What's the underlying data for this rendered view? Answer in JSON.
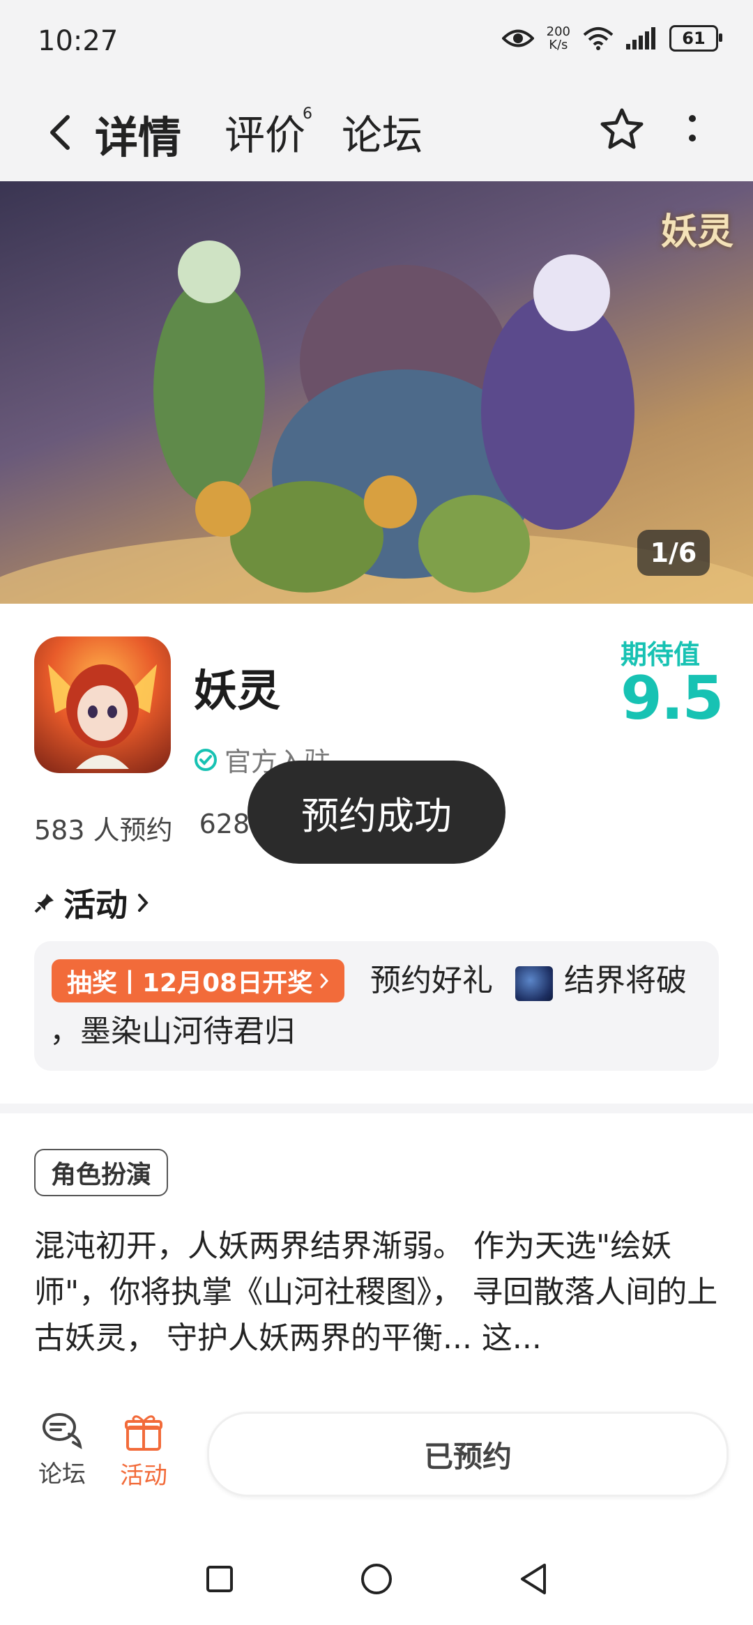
{
  "status_bar": {
    "time": "10:27",
    "network_speed_value": "200",
    "network_speed_unit": "K/s",
    "battery": "61",
    "icons": [
      "eye-icon",
      "wifi-icon",
      "signal-icon",
      "battery-icon"
    ]
  },
  "nav": {
    "tabs": [
      {
        "label": "详情",
        "active": true
      },
      {
        "label": "评价",
        "badge": "6"
      },
      {
        "label": "论坛"
      }
    ]
  },
  "banner": {
    "logo_text": "妖灵",
    "counter": "1/6"
  },
  "app": {
    "name": "妖灵",
    "official_label": "官方入驻",
    "rating_label": "期待值",
    "rating_value": "9.5",
    "reservations": "583 人预约",
    "followers_partial": "628"
  },
  "toast": "预约成功",
  "activity": {
    "title": "活动",
    "badge": "抽奖丨12月08日开奖",
    "text_line1a": "预约好礼",
    "text_line1b": "结界将破",
    "text_line2": "，墨染山河待君归"
  },
  "genre_tag": "角色扮演",
  "description": "混沌初开，人妖两界结界渐弱。 作为天选\"绘妖师\"，你将执掌《山河社稷图》， 寻回散落人间的上古妖灵， 守护人妖两界的平衡... 这...",
  "bottom_bar": {
    "forum_label": "论坛",
    "activity_label": "活动",
    "reserved_button": "已预约"
  },
  "colors": {
    "accent": "#17c2b3",
    "tab_underline": "#19d3c5",
    "activity_orange": "#f26b3a",
    "toast_bg": "#2b2b2b"
  }
}
